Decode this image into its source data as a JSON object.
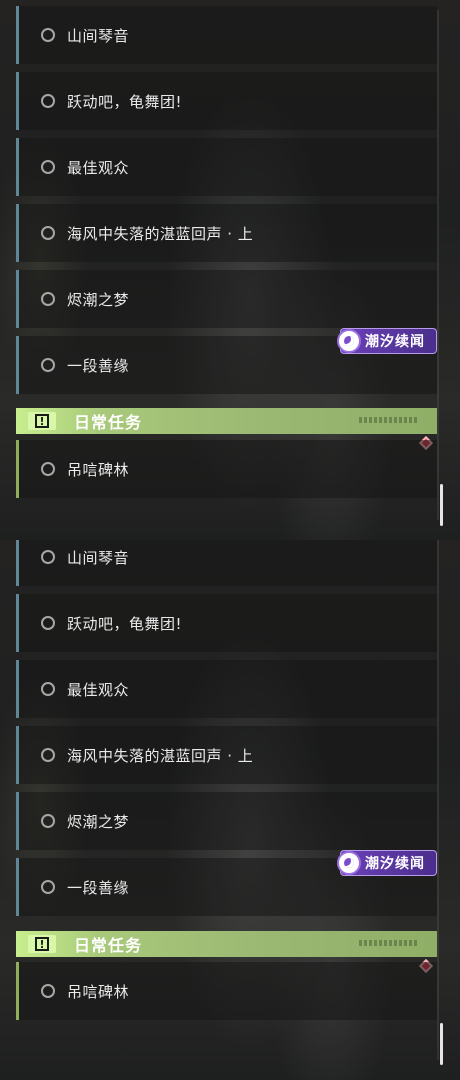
{
  "quests": [
    {
      "label": "山间琴音"
    },
    {
      "label": "跃动吧，龟舞团!"
    },
    {
      "label": "最佳观众"
    },
    {
      "label": "海风中失落的湛蓝回声 · 上"
    },
    {
      "label": "烬潮之梦"
    },
    {
      "label": "一段善缘"
    }
  ],
  "daily_section": {
    "title": "日常任务",
    "icon": "exclamation-icon"
  },
  "daily_quest": {
    "label": "吊唁碑林"
  },
  "event_badge": {
    "label": "潮汐续闻",
    "icon": "tidal-logo-icon"
  },
  "colors": {
    "quest_accent": "#5f8796",
    "daily_accent": "#a8c97a",
    "badge_purple": "#6a41b8",
    "marker_red": "#d8384a"
  }
}
